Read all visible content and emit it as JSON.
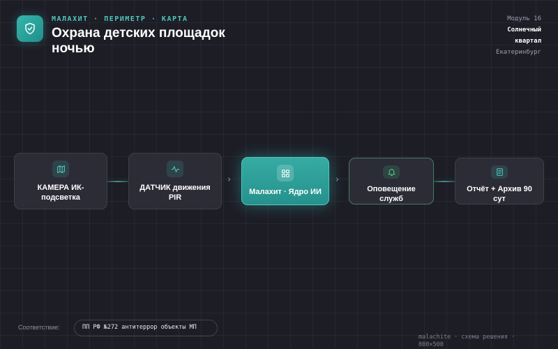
{
  "header": {
    "kicker": "МАЛАХИТ · ПЕРИМЕТР · КАРТА",
    "title": "Охрана детских площадок ночью",
    "icon": "shield-check-icon"
  },
  "meta": {
    "module": "Модуль 16",
    "district_line1": "Солнечный",
    "district_line2": "квартал",
    "city": "Екатеринбург"
  },
  "flow": {
    "nodes": [
      {
        "label": "КАМЕРА ИК-подсветка",
        "icon": "map-icon"
      },
      {
        "label": "ДАТЧИК движения PIR",
        "icon": "activity-icon"
      },
      {
        "label": "Малахит · Ядро ИИ",
        "icon": "grid-icon"
      },
      {
        "label": "Оповещение служб",
        "icon": "bell-icon"
      },
      {
        "label": "Отчёт + Архив 90 сут",
        "icon": "document-icon"
      }
    ],
    "colors": {
      "accent": "#36b5ad",
      "alert": "#5abe8c",
      "background": "#1d1d26"
    }
  },
  "compliance": {
    "label": "Соответствие:",
    "value": "ПП РФ №272 антитеррор объекты МП"
  },
  "footer": {
    "line1": "malachite · схема решения ·",
    "line2": "800×500"
  }
}
